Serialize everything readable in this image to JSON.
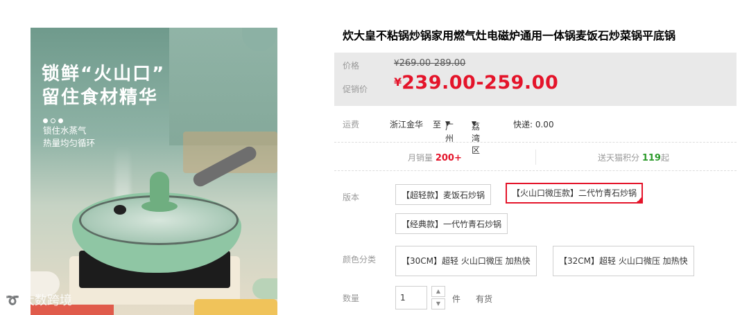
{
  "gallery": {
    "promo_title_line1": "锁鲜“火山口”",
    "promo_title_line2": "留住食材精华",
    "promo_sub_line1": "锁住水蒸气",
    "promo_sub_line2": "热量均匀循环",
    "watermark_text": "大数跨境"
  },
  "product": {
    "title": "炊大皇不粘锅炒锅家用燃气灶电磁炉通用一体锅麦饭石炒菜锅平底锅"
  },
  "price": {
    "label": "价格",
    "original_currency": "¥",
    "original_range": "269.00-289.00",
    "promo_label": "促销价",
    "promo_currency": "¥",
    "promo_range": "239.00-259.00"
  },
  "shipping": {
    "label": "运费",
    "from": "浙江金华",
    "to_label": "至",
    "city": "广州",
    "district": "荔湾区",
    "express": "快递: 0.00"
  },
  "stats": {
    "monthly_sales_label": "月销量",
    "monthly_sales_value": "200+",
    "points_label": "送天猫积分",
    "points_value": "119",
    "points_suffix": "起"
  },
  "version": {
    "label": "版本",
    "options": [
      "【超轻款】麦饭石炒锅",
      "【火山口微压款】二代竹青石炒锅",
      "【经典款】一代竹青石炒锅"
    ],
    "selected_index": 1
  },
  "color": {
    "label": "颜色分类",
    "options": [
      "【30CM】超轻 火山口微压 加热快",
      "【32CM】超轻 火山口微压 加热快"
    ]
  },
  "quantity": {
    "label": "数量",
    "value": "1",
    "unit": "件",
    "stock": "有货"
  },
  "colors": {
    "accent_red": "#e4142a",
    "points_green": "#2b9a2a",
    "price_bg": "#e9e9e9"
  }
}
